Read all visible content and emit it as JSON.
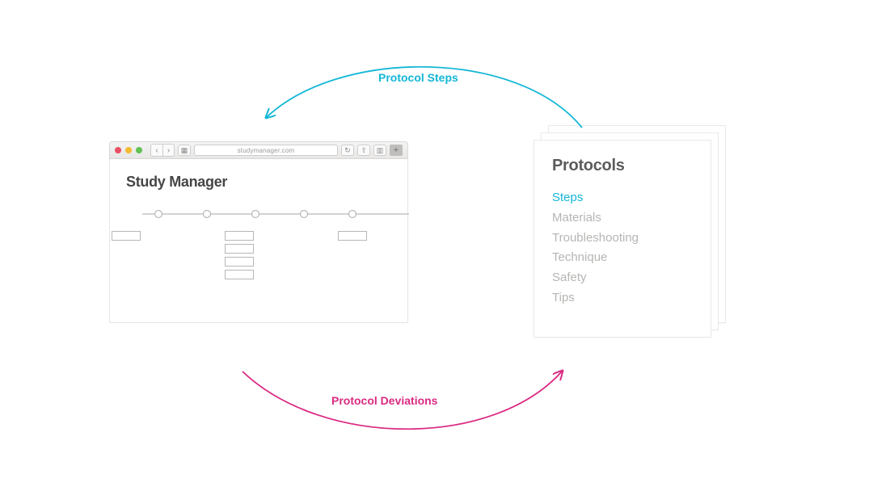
{
  "colors": {
    "cyan": "#13b7d6",
    "magenta": "#da2b82",
    "traffic_red": "#e94e63",
    "traffic_yellow": "#f5bb2f",
    "traffic_green": "#62c254"
  },
  "arrows": {
    "top_label": "Protocol Steps",
    "bottom_label": "Protocol Deviations"
  },
  "browser": {
    "url": "studymanager.com",
    "app_title": "Study Manager"
  },
  "protocols": {
    "title": "Protocols",
    "items": [
      {
        "label": "Steps",
        "active": true
      },
      {
        "label": "Materials",
        "active": false
      },
      {
        "label": "Troubleshooting",
        "active": false
      },
      {
        "label": "Technique",
        "active": false
      },
      {
        "label": "Safety",
        "active": false
      },
      {
        "label": "Tips",
        "active": false
      }
    ]
  }
}
